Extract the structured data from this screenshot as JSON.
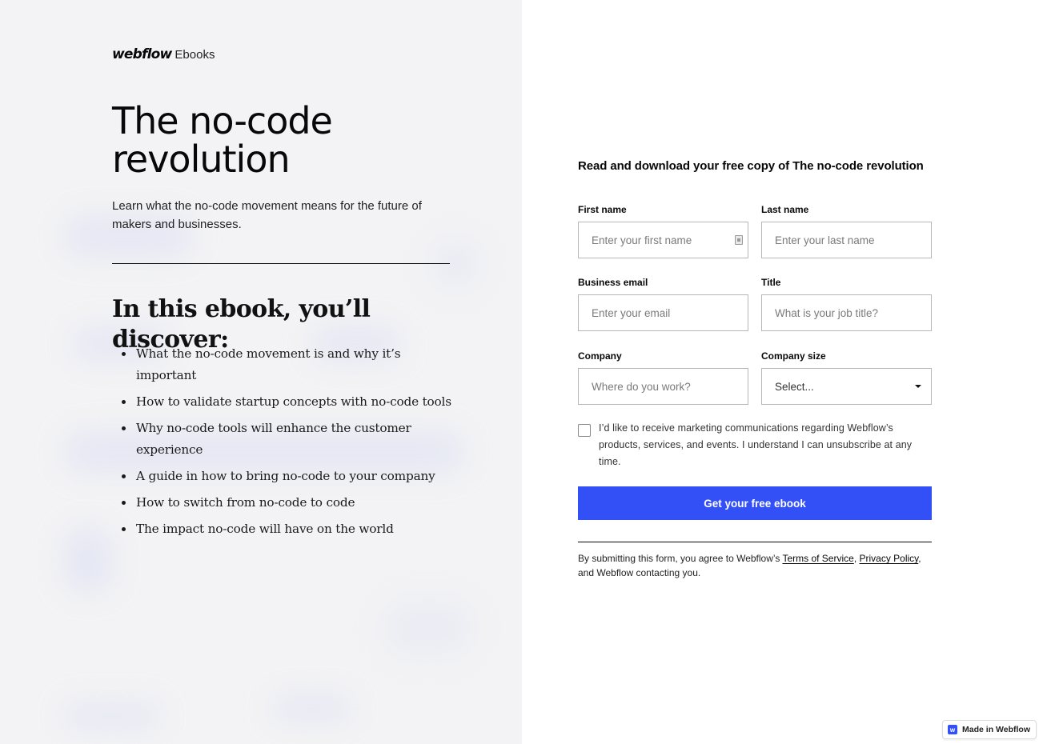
{
  "brand": {
    "logo_text": "webflow",
    "logo_sub": "Ebooks",
    "accent_color": "#3350f7"
  },
  "hero": {
    "title": "The no-code revolution",
    "subtitle": "Learn what the no-code movement means for the future of makers and businesses."
  },
  "discover": {
    "title": "In this ebook, you’ll discover:",
    "items": [
      "What the no-code movement is and why it’s important",
      "How to validate startup concepts with no-code tools",
      "Why no-code tools will enhance the customer experience",
      "A guide in how to bring no-code to your company",
      "How to switch from no-code to code",
      "The impact no-code will have on the world"
    ]
  },
  "form": {
    "title": "Read and download your free copy of The no-code revolution",
    "fields": {
      "first_name": {
        "label": "First name",
        "placeholder": "Enter your first name",
        "value": ""
      },
      "last_name": {
        "label": "Last name",
        "placeholder": "Enter your last name",
        "value": ""
      },
      "email": {
        "label": "Business email",
        "placeholder": "Enter your email",
        "value": ""
      },
      "title": {
        "label": "Title",
        "placeholder": "What is your job title?",
        "value": ""
      },
      "company": {
        "label": "Company",
        "placeholder": "Where do you work?",
        "value": ""
      },
      "company_size": {
        "label": "Company size",
        "selected": "Select..."
      }
    },
    "consent": {
      "checked": false,
      "text": "I’d like to receive marketing communications regarding Webflow’s products, services, and events. I understand I can unsubscribe at any time."
    },
    "submit_label": "Get your free ebook",
    "legal": {
      "prefix": "By submitting this form, you agree to Webflow’s ",
      "terms_link": "Terms of Service",
      "separator": ", ",
      "privacy_link": "Privacy Policy",
      "suffix": ", and Webflow contacting you."
    }
  },
  "badge": {
    "icon_letter": "w",
    "label": "Made in Webflow"
  }
}
